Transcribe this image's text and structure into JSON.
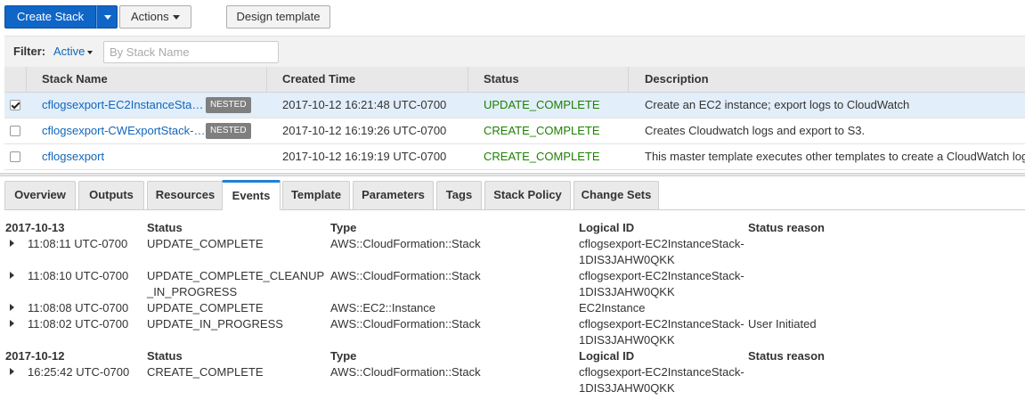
{
  "toolbar": {
    "create_stack": "Create Stack",
    "actions": "Actions",
    "design_template": "Design template"
  },
  "filter": {
    "label": "Filter:",
    "active": "Active",
    "placeholder": "By Stack Name"
  },
  "table": {
    "headers": [
      "Stack Name",
      "Created Time",
      "Status",
      "Description"
    ],
    "rows": [
      {
        "name": "cflogsexport-EC2InstanceSta…",
        "badge": "NESTED",
        "created": "2017-10-12 16:21:48 UTC-0700",
        "status": "UPDATE_COMPLETE",
        "description": "Create an EC2 instance; export logs to CloudWatch",
        "checked": true
      },
      {
        "name": "cflogsexport-CWExportStack-…",
        "badge": "NESTED",
        "created": "2017-10-12 16:19:26 UTC-0700",
        "status": "CREATE_COMPLETE",
        "description": "Creates Cloudwatch logs and export to S3.",
        "checked": false
      },
      {
        "name": "cflogsexport",
        "badge": "",
        "created": "2017-10-12 16:19:19 UTC-0700",
        "status": "CREATE_COMPLETE",
        "description": "This master template executes other templates to create a CloudWatch log g",
        "checked": false
      }
    ]
  },
  "tabs": [
    "Overview",
    "Outputs",
    "Resources",
    "Events",
    "Template",
    "Parameters",
    "Tags",
    "Stack Policy",
    "Change Sets"
  ],
  "active_tab": "Events",
  "events": {
    "headers": {
      "status": "Status",
      "type": "Type",
      "logical_id": "Logical ID",
      "reason": "Status reason"
    },
    "groups": [
      {
        "date": "2017-10-13",
        "items": [
          {
            "time": "11:08:11 UTC-0700",
            "status_lines": [
              "UPDATE_COMPLETE"
            ],
            "status_color": "green",
            "type": "AWS::CloudFormation::Stack",
            "logical_lines": [
              "cflogsexport-EC2InstanceStack-",
              "1DIS3JAHW0QKK"
            ],
            "reason": ""
          },
          {
            "time": "11:08:10 UTC-0700",
            "status_lines": [
              "UPDATE_COMPLETE_CLEANUP",
              "_IN_PROGRESS"
            ],
            "status_color": "orange",
            "type": "AWS::CloudFormation::Stack",
            "logical_lines": [
              "cflogsexport-EC2InstanceStack-",
              "1DIS3JAHW0QKK"
            ],
            "reason": ""
          },
          {
            "time": "11:08:08 UTC-0700",
            "status_lines": [
              "UPDATE_COMPLETE"
            ],
            "status_color": "green",
            "type": "AWS::EC2::Instance",
            "logical_lines": [
              "EC2Instance"
            ],
            "reason": ""
          },
          {
            "time": "11:08:02 UTC-0700",
            "status_lines": [
              "UPDATE_IN_PROGRESS"
            ],
            "status_color": "orange",
            "type": "AWS::CloudFormation::Stack",
            "logical_lines": [
              "cflogsexport-EC2InstanceStack-",
              "1DIS3JAHW0QKK"
            ],
            "reason": "User Initiated"
          }
        ]
      },
      {
        "date": "2017-10-12",
        "items": [
          {
            "time": "16:25:42 UTC-0700",
            "status_lines": [
              "CREATE_COMPLETE"
            ],
            "status_color": "green",
            "type": "AWS::CloudFormation::Stack",
            "logical_lines": [
              "cflogsexport-EC2InstanceStack-",
              "1DIS3JAHW0QKK"
            ],
            "reason": ""
          }
        ]
      }
    ]
  },
  "colors": {
    "primary": "#1066c7",
    "link": "#1166bb",
    "green": "#1d8102",
    "orange": "#ec7211",
    "tab_accent": "#1f7fd5"
  }
}
